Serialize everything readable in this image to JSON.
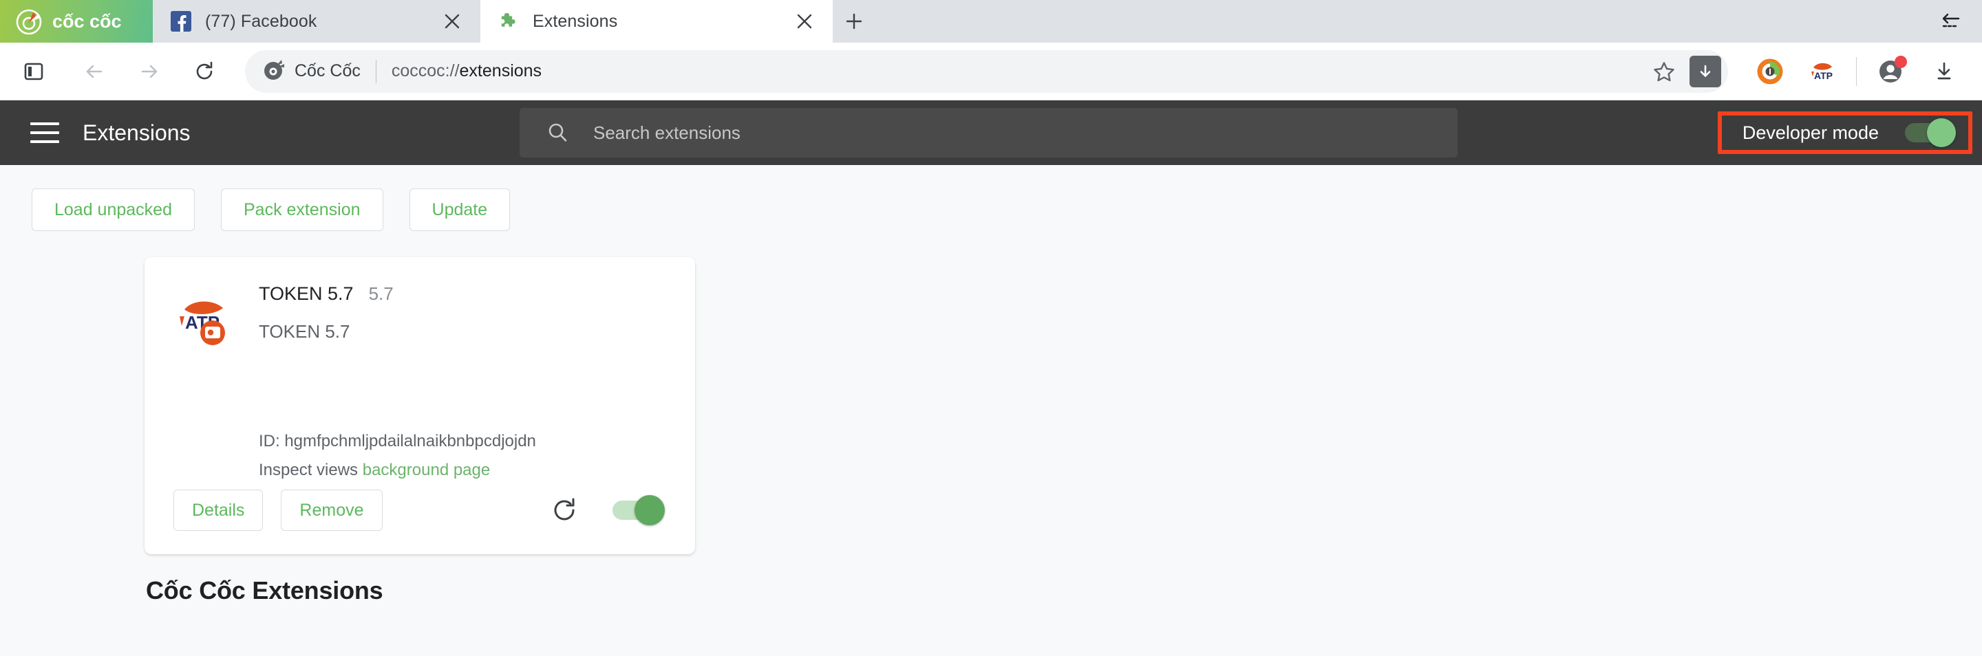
{
  "window": {
    "restore_icon": "arrow-left-dashed-icon"
  },
  "browser": {
    "brand_name": "cốc cốc",
    "tabs": [
      {
        "title": "(77) Facebook",
        "favicon": "facebook-icon",
        "active": false,
        "close_label": "×"
      },
      {
        "title": "Extensions",
        "favicon": "puzzle-piece-icon",
        "active": true,
        "close_label": "×"
      }
    ],
    "new_tab_label": "+",
    "toolbar": {
      "sidebar_icon": "sidebar-panel-icon",
      "back_icon": "arrow-back-icon",
      "forward_icon": "arrow-forward-icon",
      "reload_icon": "reload-icon",
      "omnibox": {
        "brand_icon": "coccoc-logo-icon",
        "brand_label": "Cốc Cốc",
        "url_scheme": "coccoc://",
        "url_path": "extensions",
        "url_full": "coccoc://extensions",
        "bookmark_icon": "star-icon",
        "download_icon": "download-square-icon"
      },
      "extension_icons": [
        {
          "name": "coccoc-adblock-icon"
        },
        {
          "name": "atp-token-extension-icon"
        }
      ],
      "profile_icon": "profile-avatar-icon",
      "profile_badge": true,
      "downloads_icon": "downloads-tray-icon"
    }
  },
  "extensions_page": {
    "menu_icon": "hamburger-menu-icon",
    "title": "Extensions",
    "search": {
      "icon": "search-icon",
      "placeholder": "Search extensions",
      "value": ""
    },
    "developer_mode": {
      "label": "Developer mode",
      "enabled": true,
      "highlighted": true,
      "highlight_color": "#f4411f"
    },
    "action_buttons": [
      {
        "label": "Load unpacked"
      },
      {
        "label": "Pack extension"
      },
      {
        "label": "Update"
      }
    ],
    "cards": [
      {
        "icon": "atp-token-extension-icon",
        "name": "TOKEN 5.7",
        "version": "5.7",
        "description": "TOKEN 5.7",
        "id_label": "ID: hgmfpchmljpdailalnaikbnbpcdjojdn",
        "inspect_label": "Inspect views",
        "inspect_link": "background page",
        "details_label": "Details",
        "remove_label": "Remove",
        "reload_icon": "reload-icon",
        "enabled": true
      }
    ],
    "section_heading": "Cốc Cốc Extensions"
  },
  "colors": {
    "brand_green": "#5cb85c",
    "header_dark": "#3c3c3c",
    "search_field": "#4a4a4a",
    "highlight_red": "#f4411f",
    "page_bg": "#f8f9fa",
    "tabstrip_bg": "#dee1e6"
  }
}
